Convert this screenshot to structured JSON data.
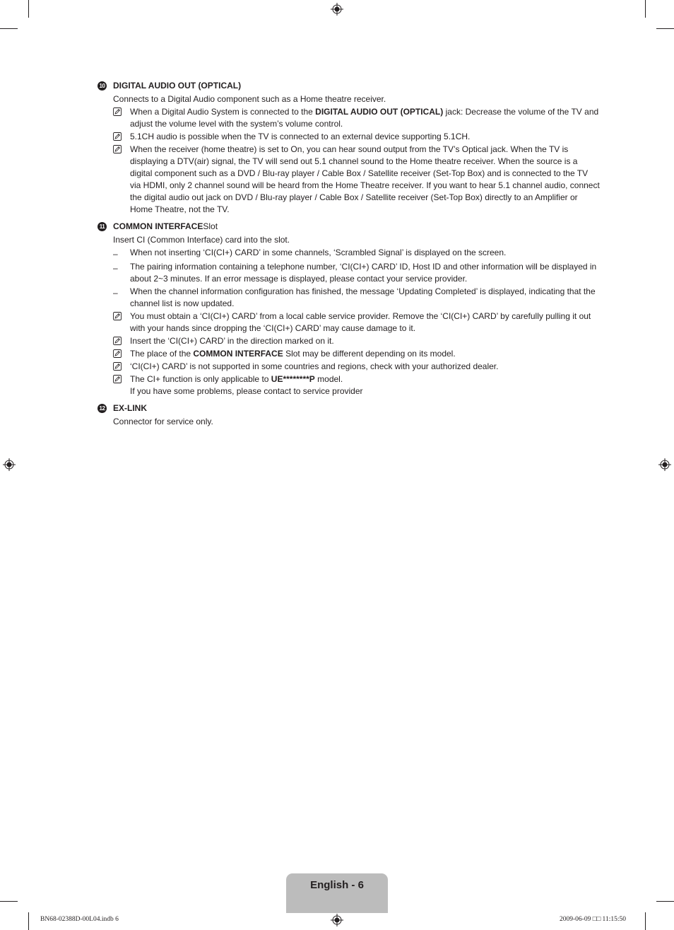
{
  "sections": [
    {
      "number": "10",
      "title_bold": "DIGITAL AUDIO OUT (OPTICAL)",
      "title_normal": "",
      "description": "Connects to a Digital Audio component such as a Home theatre receiver.",
      "items": [
        {
          "marker": "note-icon",
          "pre": "When a Digital Audio System is connected to the ",
          "bold": "DIGITAL AUDIO OUT (OPTICAL)",
          "post": " jack: Decrease the volume of the TV and adjust the volume level with the system’s volume control."
        },
        {
          "marker": "note-icon",
          "pre": "5.1CH audio is possible when the TV is connected to an external device supporting 5.1CH.",
          "bold": "",
          "post": ""
        },
        {
          "marker": "note-icon",
          "pre": "When the receiver (home theatre) is set to On, you can hear sound output from the TV’s Optical jack. When the TV is displaying a DTV(air) signal, the TV will send out 5.1 channel sound to the Home theatre receiver. When the source is a digital component such as a DVD / Blu-ray player / Cable Box / Satellite receiver (Set-Top Box) and is connected to the TV via HDMI, only 2 channel sound will be heard from the Home Theatre receiver. If you want to hear 5.1 channel audio, connect the digital audio out jack on DVD / Blu-ray player / Cable Box / Satellite receiver (Set-Top Box) directly to an Amplifier or Home Theatre, not the TV.",
          "bold": "",
          "post": ""
        }
      ]
    },
    {
      "number": "11",
      "title_bold": "COMMON INTERFACE",
      "title_normal": " Slot",
      "description": "Insert CI (Common Interface) card into the slot.",
      "items": [
        {
          "marker": "dash",
          "pre": "When not inserting ‘CI(CI+) CARD’ in some channels, ‘Scrambled Signal’ is displayed on the screen.",
          "bold": "",
          "post": ""
        },
        {
          "marker": "dash",
          "pre": "The pairing information containing a telephone number, ‘CI(CI+) CARD’ ID, Host ID and other information will be displayed in about 2~3 minutes. If an error message is displayed, please contact your service provider.",
          "bold": "",
          "post": ""
        },
        {
          "marker": "dash",
          "pre": "When the channel information configuration has finished, the message ‘Updating Completed’ is displayed, indicating that the channel list is now updated.",
          "bold": "",
          "post": ""
        },
        {
          "marker": "note-icon",
          "pre": "You must obtain a ‘CI(CI+) CARD’ from a local cable service provider. Remove the ‘CI(CI+) CARD’ by carefully pulling it out with your hands since dropping the ‘CI(CI+) CARD’ may cause damage to it.",
          "bold": "",
          "post": ""
        },
        {
          "marker": "note-icon",
          "pre": "Insert the ‘CI(CI+) CARD’ in the direction marked on it.",
          "bold": "",
          "post": ""
        },
        {
          "marker": "note-icon",
          "pre": "The place of the ",
          "bold": "COMMON INTERFACE",
          "post": " Slot may be different depending on its model."
        },
        {
          "marker": "note-icon",
          "pre": "‘CI(CI+) CARD’ is not supported in some countries and regions, check with your authorized dealer.",
          "bold": "",
          "post": ""
        },
        {
          "marker": "note-icon",
          "pre": "The CI+ function is only applicable to ",
          "bold": "UE********P",
          "post": " model.",
          "extra_line": "If you have some problems, please contact to service provider"
        }
      ]
    },
    {
      "number": "12",
      "title_bold": "EX-LINK",
      "title_normal": "",
      "description": "Connector for service only.",
      "items": []
    }
  ],
  "dash_char": "–",
  "footer": {
    "page_label": "English - 6",
    "slug_left": "BN68-02388D-00L04.indb   6",
    "slug_right": "2009-06-09   □□ 11:15:50"
  }
}
